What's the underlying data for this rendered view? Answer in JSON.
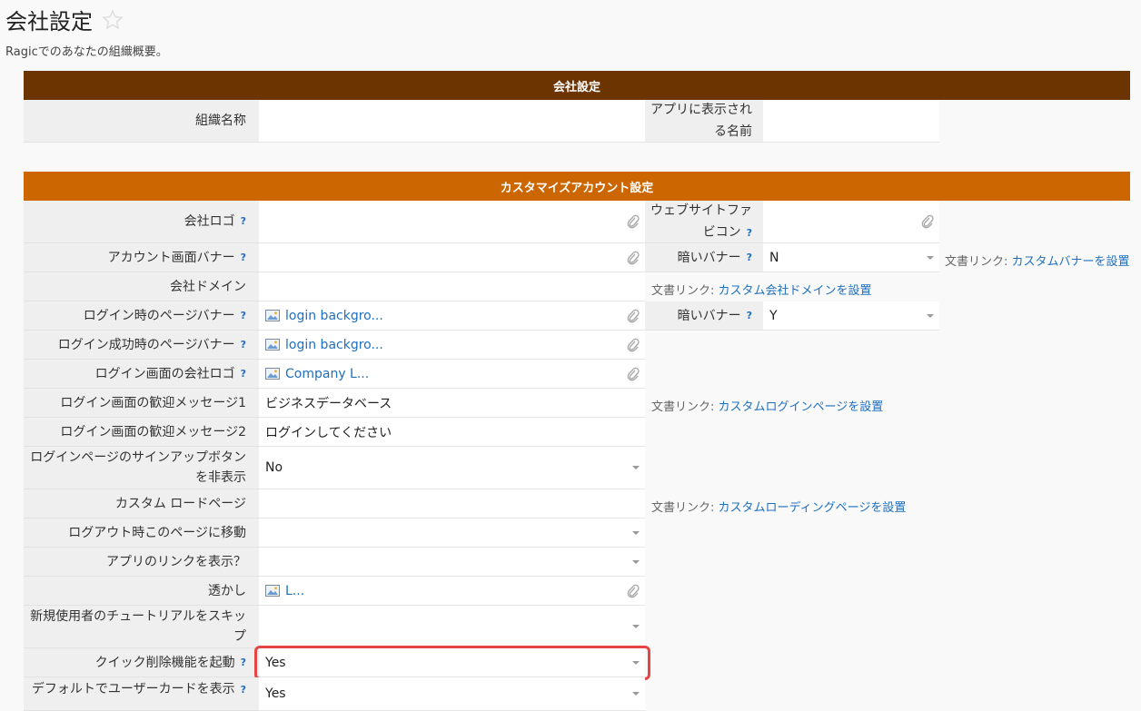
{
  "page": {
    "title": "会社設定",
    "subtitle": "Ragicでのあなたの組織概要。"
  },
  "sections": {
    "company": "会社設定",
    "custom": "カスタマイズアカウント設定"
  },
  "company": {
    "org_name_label": "組織名称",
    "app_name_label": "アプリに表示される名前"
  },
  "fields": {
    "company_logo": "会社ロゴ",
    "favicon": "ウェブサイトファビコン",
    "account_banner": "アカウント画面バナー",
    "dark_banner_1": "暗いバナー",
    "dark_banner_1_value": "N",
    "company_domain": "会社ドメイン",
    "login_banner": "ログイン時のページバナー",
    "login_banner_file": "login backgro...",
    "dark_banner_2": "暗いバナー",
    "dark_banner_2_value": "Y",
    "login_success_banner": "ログイン成功時のページバナー",
    "login_success_banner_file": "login backgro...",
    "login_logo": "ログイン画面の会社ロゴ",
    "login_logo_file": "Company L...",
    "welcome1": "ログイン画面の歓迎メッセージ1",
    "welcome1_value": "ビジネスデータベース",
    "welcome2": "ログイン画面の歓迎メッセージ2",
    "welcome2_value": "ログインしてください",
    "hide_signup": "ログインページのサインアップボタンを非表示",
    "hide_signup_value": "No",
    "custom_loading": "カスタム ロードページ",
    "logout_redirect": "ログアウト時このページに移動",
    "show_app_link": "アプリのリンクを表示？",
    "watermark": "透かし",
    "watermark_file": "L...",
    "skip_tutorial": "新規使用者のチュートリアルをスキップ",
    "quick_delete": "クイック削除機能を起動",
    "quick_delete_value": "Yes",
    "default_user_card": "デフォルトでユーザーカードを表示",
    "default_user_card_value": "Yes"
  },
  "notes": {
    "prefix": "文書リンク: ",
    "custom_banner": "カスタムバナーを設置",
    "custom_domain": "カスタム会社ドメインを設置",
    "custom_login": "カスタムログインページを設置",
    "custom_loading": "カスタムローディングページを設置"
  },
  "help_mark": "?",
  "colors": {
    "header_brown": "#6b3400",
    "header_orange": "#cc6600",
    "link": "#1e6fbf",
    "highlight": "#e64545"
  }
}
